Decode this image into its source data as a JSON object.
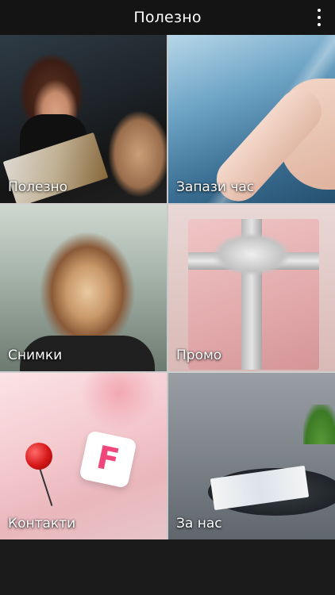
{
  "header": {
    "title": "Полезно",
    "menu_icon": "more-vert-icon"
  },
  "tiles": [
    {
      "label": "Полезно"
    },
    {
      "label": "Запази час"
    },
    {
      "label": "Снимки"
    },
    {
      "label": "Промо"
    },
    {
      "label": "Контакти"
    },
    {
      "label": "За нас"
    }
  ],
  "colors": {
    "header_bg": "#141414",
    "page_bg": "#1b1b1b",
    "text": "#ffffff",
    "foursquare_pink": "#f0467a"
  }
}
